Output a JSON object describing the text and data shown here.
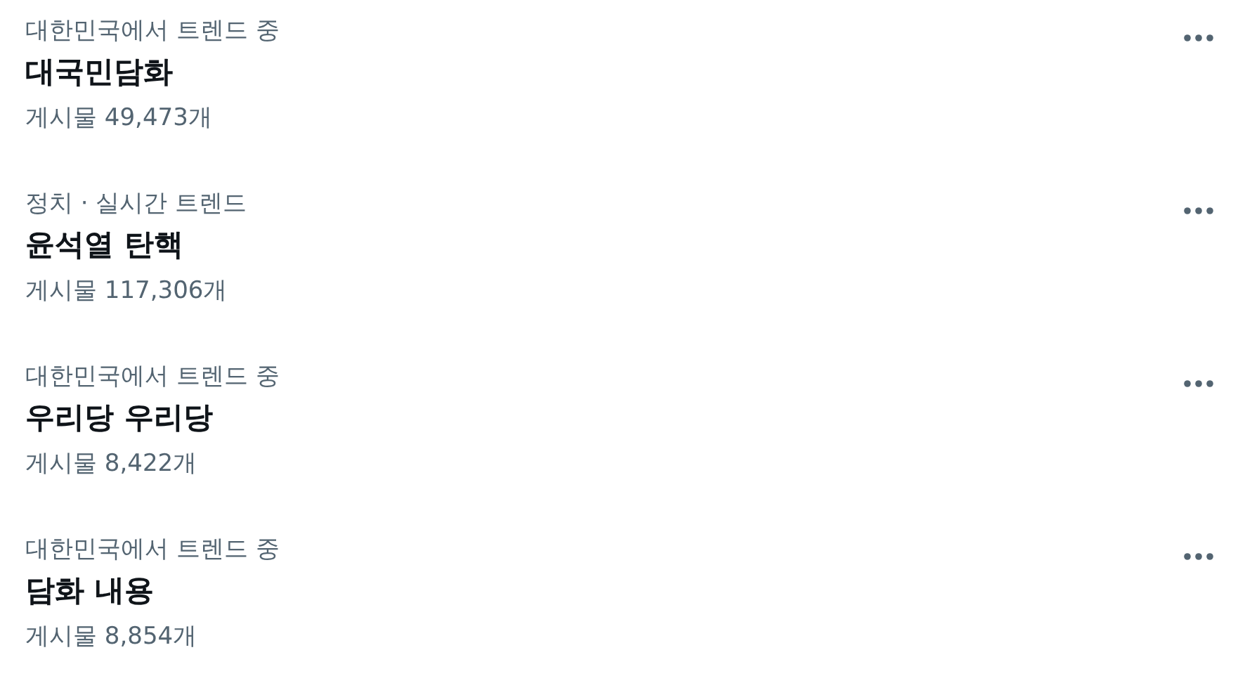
{
  "trends": [
    {
      "context": "대한민국에서 트렌드 중",
      "title": "대국민담화",
      "posts": "게시물 49,473개"
    },
    {
      "context": "정치 · 실시간 트렌드",
      "title": "윤석열 탄핵",
      "posts": "게시물 117,306개"
    },
    {
      "context": "대한민국에서 트렌드 중",
      "title": "우리당 우리당",
      "posts": "게시물 8,422개"
    },
    {
      "context": "대한민국에서 트렌드 중",
      "title": "담화 내용",
      "posts": "게시물 8,854개"
    }
  ]
}
